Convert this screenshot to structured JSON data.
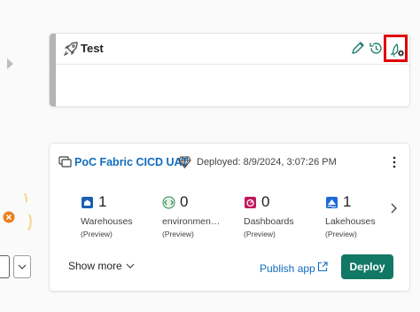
{
  "test_stage": {
    "title": "Test",
    "icons": [
      "rocket-icon",
      "edit-icon",
      "history-icon",
      "deploy-settings-icon"
    ]
  },
  "uat_stage": {
    "name": "PoC Fabric CICD UAT",
    "deployed": "Deployed: 8/9/2024, 3:07:26 PM",
    "items": [
      {
        "count": "1",
        "label": "Warehouses",
        "sub": "(Preview)",
        "icon": "warehouse-icon"
      },
      {
        "count": "0",
        "label": "environmen…",
        "sub": "(Preview)",
        "icon": "environment-icon"
      },
      {
        "count": "0",
        "label": "Dashboards",
        "sub": "(Preview)",
        "icon": "dashboard-icon"
      },
      {
        "count": "1",
        "label": "Lakehouses",
        "sub": "(Preview)",
        "icon": "lakehouse-icon"
      }
    ],
    "show_more": "Show more",
    "publish_app": "Publish app",
    "deploy": "Deploy"
  },
  "colors": {
    "accent": "#117865",
    "link": "#0f6cbd",
    "highlight": "#e00000"
  }
}
